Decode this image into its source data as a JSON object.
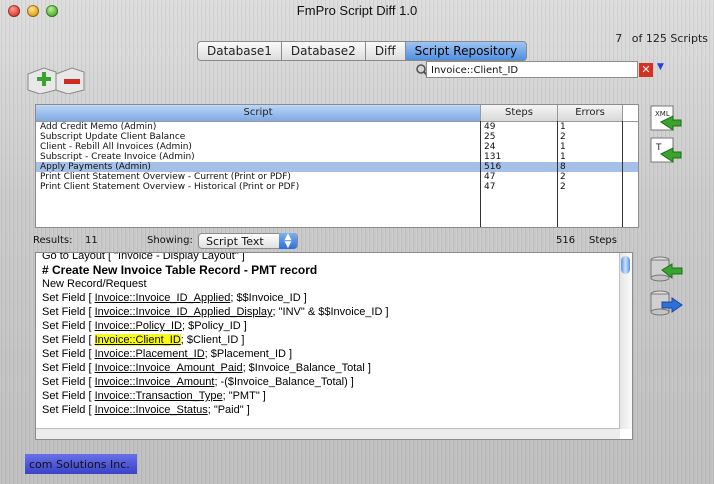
{
  "window": {
    "title": "FmPro Script Diff 1.0"
  },
  "count": {
    "current": "7",
    "total_label": "of 125  Scripts"
  },
  "tabs": [
    {
      "label": "Database1"
    },
    {
      "label": "Database2"
    },
    {
      "label": "Diff"
    },
    {
      "label": "Script Repository",
      "active": true
    }
  ],
  "search": {
    "value": "Invoice::Client_ID"
  },
  "script_list": {
    "columns": [
      "Script",
      "Steps",
      "Errors"
    ],
    "rows": [
      {
        "script": "Add Credit Memo (Admin)",
        "steps": "49",
        "errors": "1"
      },
      {
        "script": "Subscript Update Client Balance",
        "steps": "25",
        "errors": "2"
      },
      {
        "script": "Client - Rebill All Invoices (Admin)",
        "steps": "24",
        "errors": "1"
      },
      {
        "script": "Subscript - Create Invoice (Admin)",
        "steps": "131",
        "errors": "1"
      },
      {
        "script": "Apply Payments (Admin)",
        "steps": "516",
        "errors": "8",
        "selected": true
      },
      {
        "script": "Print Client Statement Overview - Current (Print or PDF)",
        "steps": "47",
        "errors": "2"
      },
      {
        "script": "Print Client Statement Overview - Historical (Print or PDF)",
        "steps": "47",
        "errors": "2"
      }
    ]
  },
  "results": {
    "label": "Results:",
    "count": "11",
    "showing_label": "Showing:",
    "showing_value": "Script Text",
    "steps_count": "516",
    "steps_label": "Steps"
  },
  "script_text": {
    "lines": [
      {
        "parts": [
          {
            "t": "Go to Layout [ \"Invoice - Display Layout\" ]"
          }
        ]
      },
      {
        "parts": [
          {
            "t": "#  Create New Invoice Table Record - PMT record"
          }
        ],
        "comment": true
      },
      {
        "parts": [
          {
            "t": "New Record/Request"
          }
        ]
      },
      {
        "parts": [
          {
            "t": "Set Field [ "
          },
          {
            "t": "Invoice::Invoice_ID_Applied",
            "u": true
          },
          {
            "t": "; $$Invoice_ID ]"
          }
        ]
      },
      {
        "parts": [
          {
            "t": "Set Field [ "
          },
          {
            "t": "Invoice::Invoice_ID_Applied_Display",
            "u": true
          },
          {
            "t": "; \"INV\" & $$Invoice_ID ]"
          }
        ]
      },
      {
        "parts": [
          {
            "t": "Set Field [ "
          },
          {
            "t": "Invoice::Policy_ID",
            "u": true
          },
          {
            "t": "; $Policy_ID ]"
          }
        ]
      },
      {
        "parts": [
          {
            "t": "Set Field [ "
          },
          {
            "t": "Invoice::Client_ID",
            "u": true,
            "hl": true
          },
          {
            "t": "; $Client_ID ]"
          }
        ]
      },
      {
        "parts": [
          {
            "t": "Set Field [ "
          },
          {
            "t": "Invoice::Placement_ID",
            "u": true
          },
          {
            "t": "; $Placement_ID ]"
          }
        ]
      },
      {
        "parts": [
          {
            "t": "Set Field [ "
          },
          {
            "t": "Invoice::Invoice_Amount_Paid",
            "u": true
          },
          {
            "t": "; $Invoice_Balance_Total ]"
          }
        ]
      },
      {
        "parts": [
          {
            "t": "Set Field [ "
          },
          {
            "t": "Invoice::Invoice_Amount",
            "u": true
          },
          {
            "t": "; -($Invoice_Balance_Total) ]"
          }
        ]
      },
      {
        "parts": [
          {
            "t": "Set Field [ "
          },
          {
            "t": "Invoice::Transaction_Type",
            "u": true
          },
          {
            "t": "; \"PMT\" ]"
          }
        ]
      },
      {
        "parts": [
          {
            "t": "Set Field [ "
          },
          {
            "t": "Invoice::Invoice_Status",
            "u": true
          },
          {
            "t": "; \"Paid\" ]"
          }
        ]
      }
    ]
  },
  "footer": {
    "label": "com Solutions Inc."
  },
  "icons": {
    "add": "add-script-icon",
    "remove": "remove-script-icon",
    "xml_export": "xml-export-icon",
    "text_export": "text-export-icon",
    "db_import": "database-import-icon",
    "db_export": "database-export-icon"
  },
  "colors": {
    "selection": "#a5bfe6",
    "highlight": "#fbfb1a",
    "tab_active": "#4f8fe0",
    "footer": "#4a52d8"
  }
}
